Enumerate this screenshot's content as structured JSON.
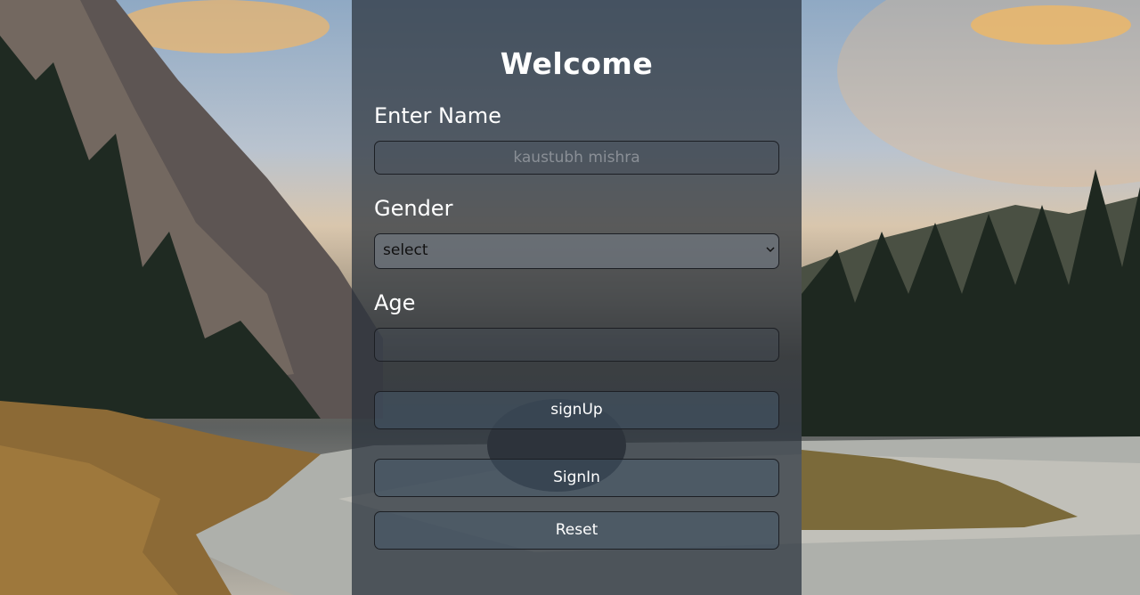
{
  "form": {
    "title": "Welcome",
    "name_label": "Enter Name",
    "name_placeholder": "kaustubh mishra",
    "name_value": "",
    "gender_label": "Gender",
    "gender_selected": "select",
    "age_label": "Age",
    "age_value": "",
    "signup_label": "signUp",
    "signin_label": "SignIn",
    "reset_label": "Reset"
  },
  "colors": {
    "panel_overlay": "#28303a",
    "text": "#ffffff",
    "placeholder": "#8a8f96",
    "border": "#1c1f24"
  },
  "icons": {
    "gender_dropdown": "chevron-down-icon"
  }
}
